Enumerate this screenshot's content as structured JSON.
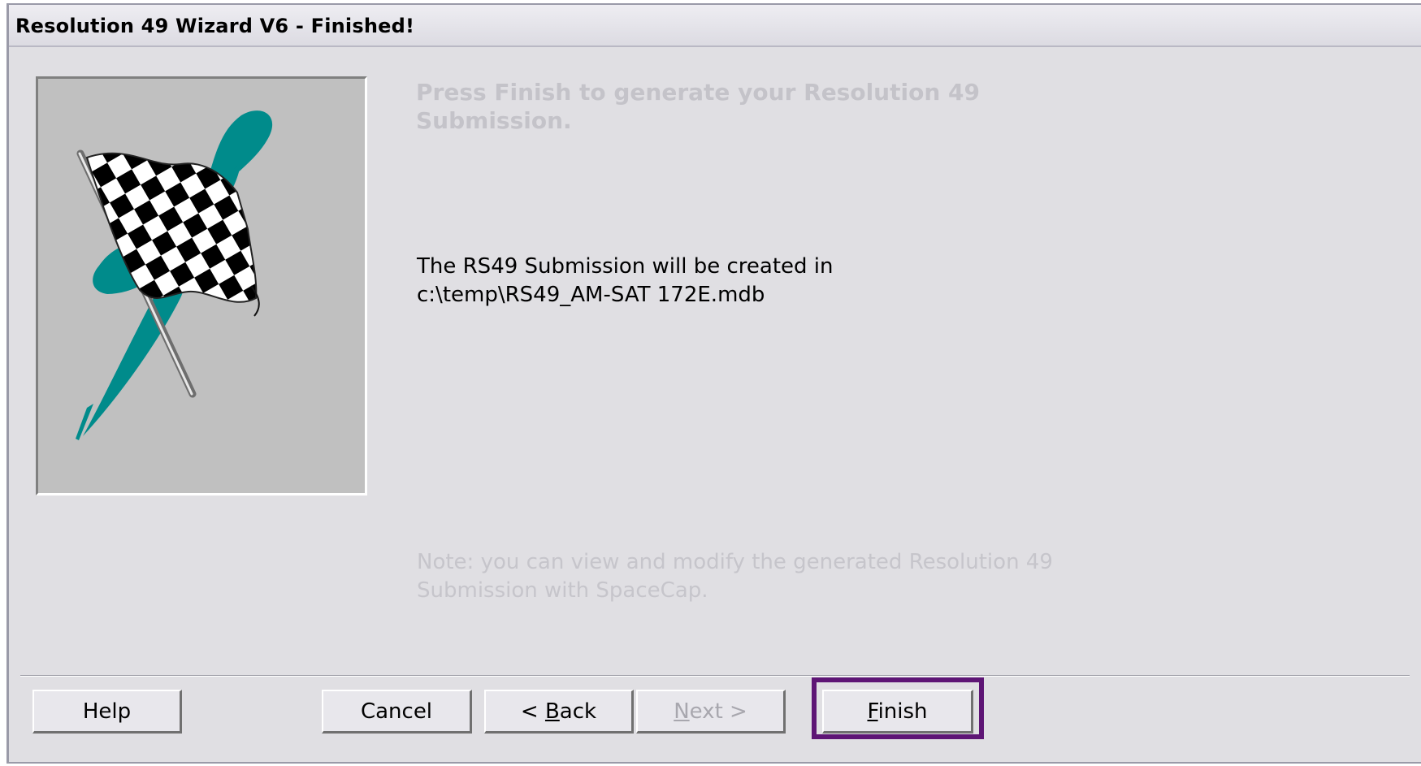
{
  "window": {
    "title": "Resolution 49 Wizard V6 - Finished!"
  },
  "content": {
    "heading_line1": "Press Finish to generate your Resolution 49",
    "heading_line2": "Submission.",
    "info_line1": "The RS49 Submission will be created in",
    "info_line2": "c:\\temp\\RS49_AM-SAT 172E.mdb",
    "note_line1": "Note:  you can view and modify the generated Resolution 49",
    "note_line2": "Submission with SpaceCap."
  },
  "image": {
    "icon": "checkered-flag-icon"
  },
  "buttons": {
    "help": "Help",
    "cancel": "Cancel",
    "back_prefix": "< ",
    "back_mnemonic": "B",
    "back_rest": "ack",
    "next_mnemonic": "N",
    "next_rest": "ext >",
    "finish_mnemonic": "F",
    "finish_rest": "inish",
    "next_enabled": false
  },
  "colors": {
    "dialog_bg": "#e0dfe3",
    "highlight": "#5e1575",
    "teal": "#008b8b"
  }
}
